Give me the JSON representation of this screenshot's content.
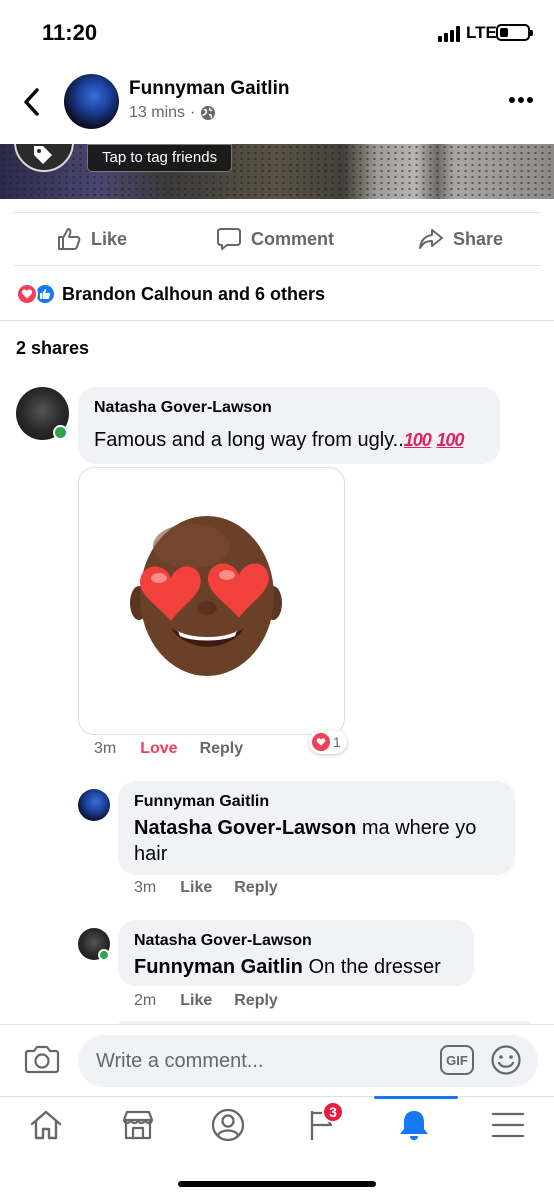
{
  "status_bar": {
    "time": "11:20",
    "network": "LTE",
    "battery_level": 0.3
  },
  "header": {
    "author": "Funnyman Gaitlin",
    "time_ago": "13 mins",
    "separator": "·",
    "icons": {
      "back": "chevron-left-icon",
      "privacy": "globe-icon",
      "more": "more-dots-icon"
    }
  },
  "photo": {
    "tag_tooltip": "Tap to tag friends"
  },
  "actions": {
    "like": "Like",
    "comment": "Comment",
    "share": "Share"
  },
  "reactions": {
    "summary": "Brandon Calhoun and 6 others",
    "types": [
      "love",
      "like"
    ]
  },
  "shares": "2 shares",
  "comments": [
    {
      "author": "Natasha Gover-Lawson",
      "text": "Famous and a long way from ugly..",
      "emoji": [
        "100",
        "100"
      ],
      "attachment": "memoji-heart-eyes",
      "time": "3m",
      "reacted_label": "Love",
      "reply_label": "Reply",
      "reaction_count": "1",
      "online": true,
      "replies": [
        {
          "author": "Funnyman Gaitlin",
          "mention": "Natasha Gover-Lawson",
          "text": " ma where yo",
          "text_line2": "hair",
          "time": "3m",
          "like_label": "Like",
          "reply_label": "Reply"
        },
        {
          "author": "Natasha Gover-Lawson",
          "mention": "Funnyman Gaitlin",
          "text": " On the dresser",
          "time": "2m",
          "like_label": "Like",
          "reply_label": "Reply",
          "online": true
        }
      ]
    }
  ],
  "composer": {
    "placeholder": "Write a comment...",
    "gif_label": "GIF"
  },
  "tabbar": {
    "items": [
      "home-icon",
      "marketplace-icon",
      "profile-icon",
      "pages-icon",
      "notifications-icon",
      "menu-icon"
    ],
    "pages_badge": "3",
    "active": "notifications-icon"
  },
  "colors": {
    "accent": "#1877f2",
    "love": "#f33e58",
    "online": "#31a24c",
    "badge": "#e41e3f",
    "secondary_text": "#65676b"
  }
}
